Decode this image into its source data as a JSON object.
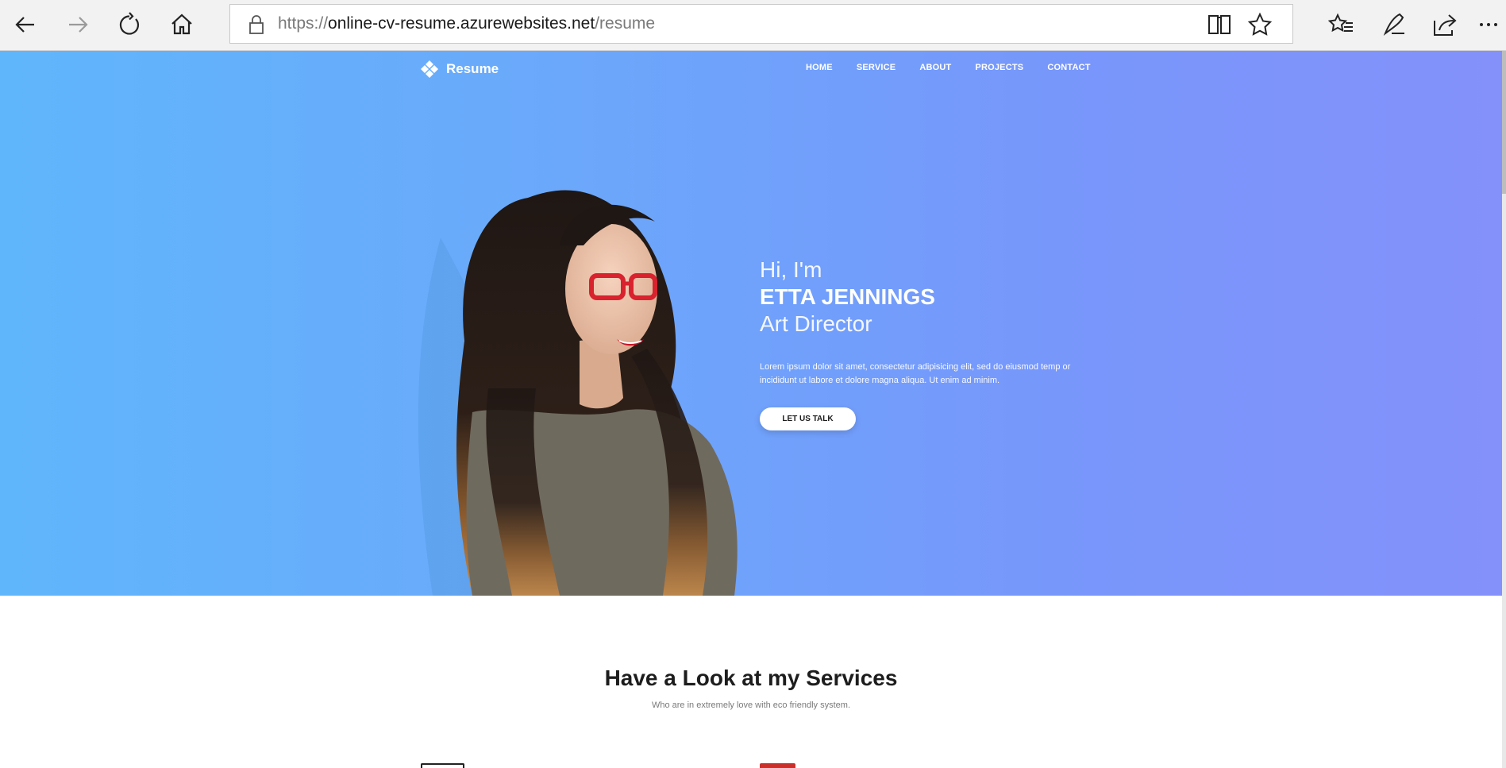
{
  "browser": {
    "url_scheme": "https://",
    "url_host": "online-cv-resume.azurewebsites.net",
    "url_path": "/resume",
    "icons": [
      "back-icon",
      "forward-icon",
      "refresh-icon",
      "home-icon",
      "lock-icon",
      "reading-view-icon",
      "favorite-star-icon",
      "favorites-list-icon",
      "pen-icon",
      "share-icon",
      "more-icon"
    ]
  },
  "site": {
    "logo_text": "Resume",
    "nav": [
      "HOME",
      "SERVICE",
      "ABOUT",
      "PROJECTS",
      "CONTACT"
    ]
  },
  "hero": {
    "greeting": "Hi, I'm",
    "name": "ETTA JENNINGS",
    "role": "Art Director",
    "description": "Lorem ipsum dolor sit amet, consectetur adipisicing elit, sed do eiusmod temp or incididunt ut labore et dolore magna aliqua. Ut enim ad minim.",
    "cta": "LET US TALK"
  },
  "services": {
    "title": "Have a Look at my Services",
    "subtitle": "Who are in extremely love with eco friendly system."
  },
  "colors": {
    "gradient_start": "#5fb6fb",
    "gradient_end": "#8491fb",
    "accent_text": "#ffffff"
  }
}
